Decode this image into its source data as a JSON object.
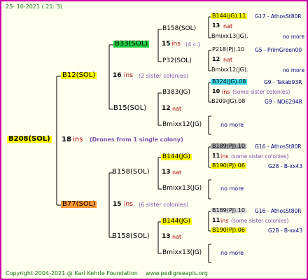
{
  "header": {
    "date": "25- 10-2021 (  21:  3)"
  },
  "footer": {
    "copyright": "Copyright 2004-2021 @ Karl Kehrle Foundation",
    "url": "www.pedigreeapis.org"
  },
  "root": {
    "label": "B208(SOL)",
    "ins": "18",
    "ins_word": "ins",
    "note": "(Drones from 1 single colony)"
  },
  "sire": {
    "label": "B12(SOL)",
    "ins": "16",
    "ins_word": "ins",
    "note": "(2 sister colonies)"
  },
  "dam": {
    "label": "B77(SOL)",
    "ins": "15",
    "ins_word": "ins",
    "note": "(6 sister colonies)"
  },
  "g3": [
    {
      "label": "B33(SOL)",
      "ins": "15",
      "ins_word": "ins",
      "note": "(4 c.)"
    },
    {
      "label": "B15(SOL)",
      "ins": "12",
      "ins_word": "nat"
    },
    {
      "label": "B158(SOL)",
      "ins": "13",
      "ins_word": "nat"
    },
    {
      "label": "B158(SOL)",
      "ins": "13",
      "ins_word": "nat"
    }
  ],
  "g4": [
    "B158(SOL)",
    "P32(SOL)",
    "B383(JG)",
    "Bmixx12(JG)",
    "B144(JG)",
    "Bmixx13(JG)",
    "B144(JG)",
    "Bmixx13(JG)"
  ],
  "g5": [
    {
      "sire": "B144(JG).11",
      "ins": "13",
      "ins_word": "nat",
      "dam": "Bmixx13(JG).",
      "right_top": "G17 - AthosSt80R",
      "right_bottom": "no more"
    },
    {
      "sire": "P218(PJ).10",
      "ins": "12",
      "ins_word": "nat",
      "dam": "Bmixx12(JG).",
      "right_top": "G5 - PrimGreen00",
      "right_bottom": "no more"
    },
    {
      "sire": "B324(JG).08",
      "ins": "10",
      "ins_word": "ins",
      "note": "(some sister colonies)",
      "dam": "B209(JG).08",
      "right_top": "G9 - Takab93R",
      "right_bottom": "G9 - NO6294R"
    },
    {
      "single": "no more"
    },
    {
      "sire": "B189(PJ).10",
      "ins": "11",
      "ins_word": "ins",
      "note": "(some sister colonies)",
      "dam": "B190(PJ).06",
      "right_top": "G16 - AthosSt80R",
      "right_bottom": "G28 - B-xx43"
    },
    {
      "single": "no more"
    },
    {
      "sire": "B189(PJ).10",
      "ins": "11",
      "ins_word": "ins",
      "note": "(some sister colonies)",
      "dam": "B190(PJ).06",
      "right_top": "G16 - AthosSt80R",
      "right_bottom": "G28 - B-xx43"
    },
    {
      "single": "no more"
    }
  ],
  "colors": {
    "frame": "#cc00aa",
    "lines": "#000000",
    "yellow": "#ffff00",
    "orange": "#ff9933",
    "green": "#22cc44",
    "cyan": "#44ddee",
    "grey": "#aaaaaa"
  }
}
